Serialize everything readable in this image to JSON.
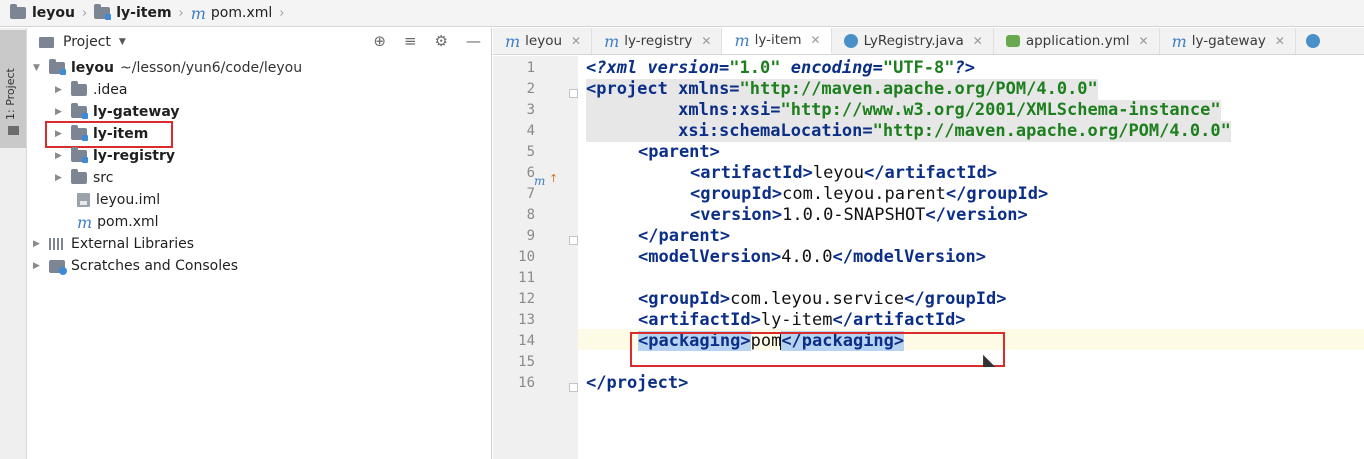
{
  "breadcrumb": {
    "items": [
      "leyou",
      "ly-item",
      "pom.xml"
    ]
  },
  "tool_stripe": {
    "label": "1: Project"
  },
  "project_panel": {
    "title": "Project",
    "tree": {
      "root_name": "leyou",
      "root_path": "~/lesson/yun6/code/leyou",
      "children": [
        ".idea",
        "ly-gateway",
        "ly-item",
        "ly-registry",
        "src",
        "leyou.iml",
        "pom.xml"
      ],
      "external_libraries": "External Libraries",
      "scratches": "Scratches and Consoles"
    }
  },
  "editor": {
    "tabs": [
      {
        "label": "leyou",
        "icon": "maven-icon"
      },
      {
        "label": "ly-registry",
        "icon": "maven-icon"
      },
      {
        "label": "ly-item",
        "icon": "maven-icon",
        "active": true
      },
      {
        "label": "LyRegistry.java",
        "icon": "java-class-icon"
      },
      {
        "label": "application.yml",
        "icon": "yaml-icon"
      },
      {
        "label": "ly-gateway",
        "icon": "maven-icon"
      }
    ],
    "line_numbers": [
      "1",
      "2",
      "3",
      "4",
      "5",
      "6",
      "7",
      "8",
      "9",
      "10",
      "11",
      "12",
      "13",
      "14",
      "15",
      "16"
    ],
    "lines": {
      "l1_a": "<?xml version=",
      "l1_b": "\"1.0\"",
      "l1_c": " encoding=",
      "l1_d": "\"UTF-8\"",
      "l1_e": "?>",
      "l2_a": "<project",
      "l2_b": " xmlns=",
      "l2_c": "\"http://maven.apache.org/POM/4.0.0\"",
      "l3_a": "         xmlns:xsi=",
      "l3_b": "\"http://www.w3.org/2001/XMLSchema-instance\"",
      "l4_a": "         xsi:schemaLocation=",
      "l4_b": "\"http://maven.apache.org/POM/4.0.0\"",
      "l5_a": "<parent>",
      "l6_a": "<artifactId>",
      "l6_b": "leyou",
      "l6_c": "</artifactId>",
      "l7_a": "<groupId>",
      "l7_b": "com.leyou.parent",
      "l7_c": "</groupId>",
      "l8_a": "<version>",
      "l8_b": "1.0.0-SNAPSHOT",
      "l8_c": "</version>",
      "l9_a": "</parent>",
      "l10_a": "<modelVersion>",
      "l10_b": "4.0.0",
      "l10_c": "</modelVersion>",
      "l12_a": "<groupId>",
      "l12_b": "com.leyou.service",
      "l12_c": "</groupId>",
      "l13_a": "<artifactId>",
      "l13_b": "ly-item",
      "l13_c": "</artifactId>",
      "l14_a": "<packaging>",
      "l14_b": "pom",
      "l14_c": "</packaging>",
      "l16_a": "</project>"
    }
  },
  "colors": {
    "highlight_border": "#d92c2c",
    "xml_tag": "#0b2e87",
    "xml_string": "#1d7f1d",
    "selection": "#b8d3f2"
  }
}
